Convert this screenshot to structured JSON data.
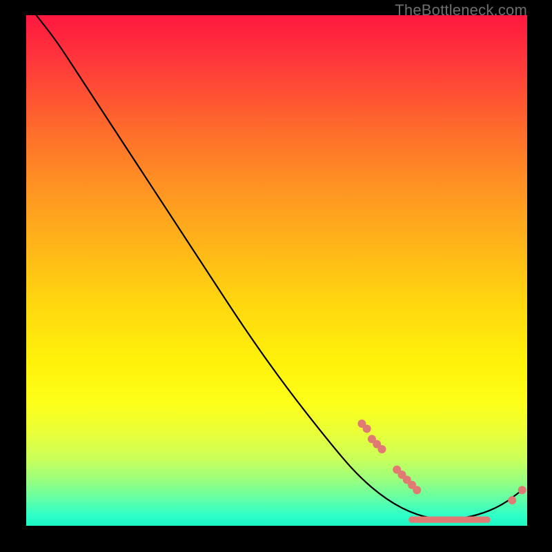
{
  "watermark": "TheBottleneck.com",
  "chart_data": {
    "type": "line",
    "title": "",
    "xlabel": "",
    "ylabel": "",
    "xlim": [
      0,
      100
    ],
    "ylim": [
      0,
      100
    ],
    "grid": false,
    "legend": false,
    "curve": {
      "name": "bottleneck-curve",
      "color": "#000000",
      "points": [
        {
          "x": 2,
          "y": 100
        },
        {
          "x": 6,
          "y": 95
        },
        {
          "x": 10,
          "y": 89
        },
        {
          "x": 14,
          "y": 83
        },
        {
          "x": 20,
          "y": 74
        },
        {
          "x": 28,
          "y": 62
        },
        {
          "x": 36,
          "y": 50
        },
        {
          "x": 44,
          "y": 38
        },
        {
          "x": 52,
          "y": 27
        },
        {
          "x": 60,
          "y": 17
        },
        {
          "x": 66,
          "y": 10
        },
        {
          "x": 72,
          "y": 5
        },
        {
          "x": 78,
          "y": 2
        },
        {
          "x": 84,
          "y": 1
        },
        {
          "x": 90,
          "y": 2
        },
        {
          "x": 95,
          "y": 4
        },
        {
          "x": 99,
          "y": 7
        }
      ]
    },
    "markers": {
      "color": "#e27a74",
      "radius": 6,
      "points": [
        {
          "x": 67,
          "y": 20
        },
        {
          "x": 68,
          "y": 19
        },
        {
          "x": 69,
          "y": 17
        },
        {
          "x": 70,
          "y": 16
        },
        {
          "x": 71,
          "y": 15
        },
        {
          "x": 74,
          "y": 11
        },
        {
          "x": 75,
          "y": 10
        },
        {
          "x": 76,
          "y": 9
        },
        {
          "x": 77,
          "y": 8
        },
        {
          "x": 78,
          "y": 7
        },
        {
          "x": 99,
          "y": 7
        },
        {
          "x": 97,
          "y": 5
        }
      ]
    },
    "marker_band": {
      "color": "#e27a74",
      "y": 1.2,
      "x_start": 77,
      "x_end": 92,
      "count": 36
    }
  }
}
